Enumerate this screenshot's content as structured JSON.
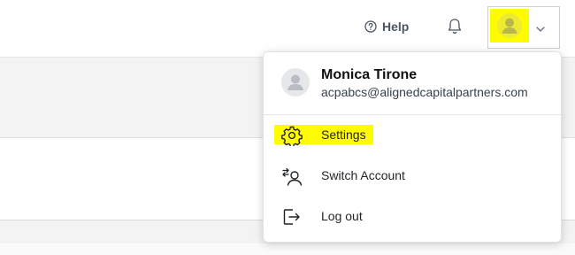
{
  "header": {
    "help_label": "Help",
    "help_icon": "help-circle-icon",
    "notifications_icon": "bell-icon",
    "avatar_icon": "user-avatar-icon",
    "chevron_icon": "chevron-down-icon",
    "highlight_color": "#fffc00"
  },
  "user_menu": {
    "name": "Monica Tirone",
    "email": "acpabcs@alignedcapitalpartners.com",
    "items": [
      {
        "label": "Settings",
        "icon": "gear-icon",
        "highlighted": true
      },
      {
        "label": "Switch Account",
        "icon": "switch-account-icon"
      },
      {
        "label": "Log out",
        "icon": "logout-icon"
      }
    ]
  }
}
